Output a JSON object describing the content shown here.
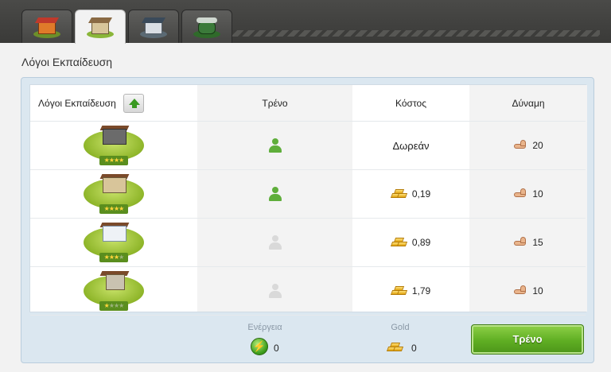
{
  "tabs": [
    {
      "icon": "house-building-icon",
      "active": false
    },
    {
      "icon": "training-school-icon",
      "active": true
    },
    {
      "icon": "warehouse-icon",
      "active": false
    },
    {
      "icon": "stadium-icon",
      "active": false
    }
  ],
  "section_title": "Λόγοι Εκπαίδευση",
  "table": {
    "headers": {
      "name": "Λόγοι Εκπαίδευση",
      "train": "Τρένο",
      "cost": "Κόστος",
      "power": "Δύναμη"
    },
    "rows": [
      {
        "stars": 4,
        "train_available": true,
        "cost": "Δωρεάν",
        "cost_is_gold": false,
        "power": "20"
      },
      {
        "stars": 4,
        "train_available": true,
        "cost": "0,19",
        "cost_is_gold": true,
        "power": "10"
      },
      {
        "stars": 3,
        "train_available": false,
        "cost": "0,89",
        "cost_is_gold": true,
        "power": "15"
      },
      {
        "stars": 1,
        "train_available": false,
        "cost": "1,79",
        "cost_is_gold": true,
        "power": "10"
      }
    ]
  },
  "footer": {
    "energy_label": "Ενέργεια",
    "energy_value": "0",
    "gold_label": "Gold",
    "gold_value": "0",
    "train_button": "Τρένο"
  },
  "colors": {
    "accent_green": "#5fae23",
    "panel_blue": "#dbe7f0"
  }
}
